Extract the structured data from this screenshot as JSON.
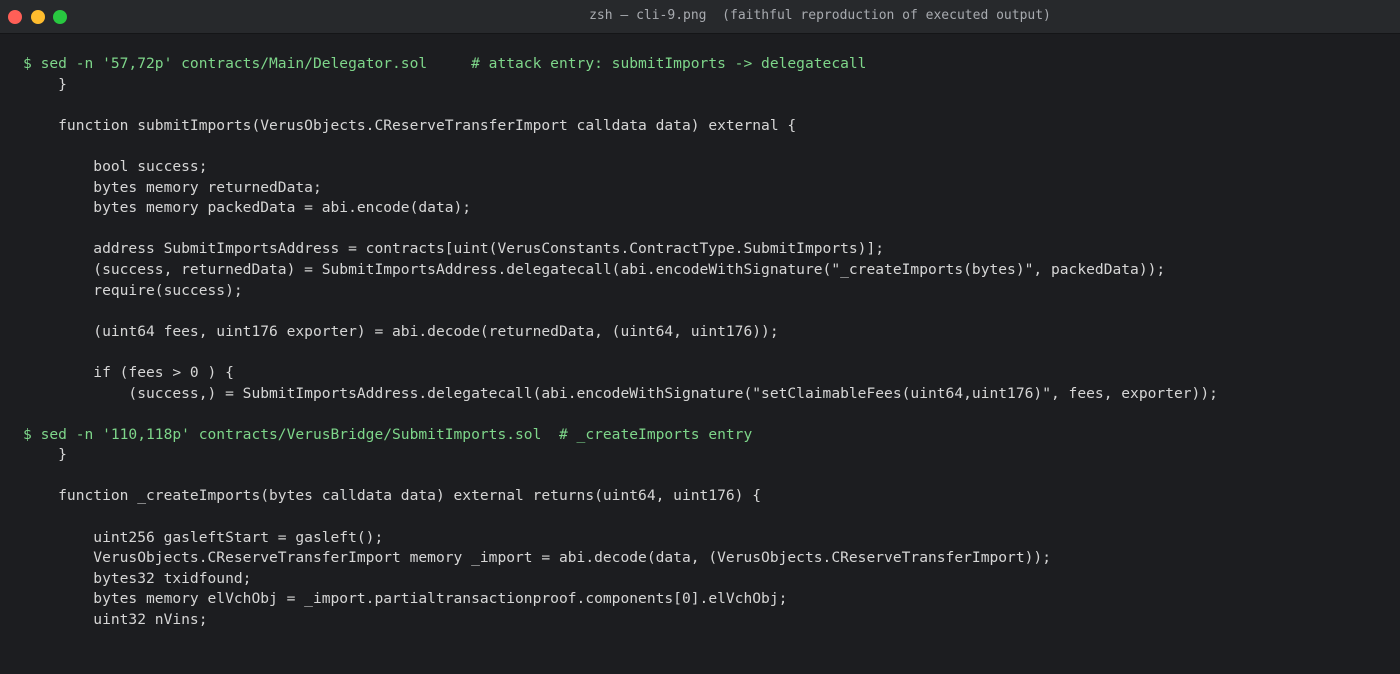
{
  "window": {
    "title": "zsh — cli-9.png  (faithful reproduction of executed output)"
  },
  "terminal": {
    "lines": [
      {
        "kind": "cmd",
        "text": "$ sed -n '57,72p' contracts/Main/Delegator.sol     # attack entry: submitImports -> delegatecall"
      },
      {
        "kind": "out",
        "text": "    }"
      },
      {
        "kind": "out",
        "text": ""
      },
      {
        "kind": "out",
        "text": "    function submitImports(VerusObjects.CReserveTransferImport calldata data) external {"
      },
      {
        "kind": "out",
        "text": ""
      },
      {
        "kind": "out",
        "text": "        bool success;"
      },
      {
        "kind": "out",
        "text": "        bytes memory returnedData;"
      },
      {
        "kind": "out",
        "text": "        bytes memory packedData = abi.encode(data);"
      },
      {
        "kind": "out",
        "text": ""
      },
      {
        "kind": "out",
        "text": "        address SubmitImportsAddress = contracts[uint(VerusConstants.ContractType.SubmitImports)];"
      },
      {
        "kind": "out",
        "text": "        (success, returnedData) = SubmitImportsAddress.delegatecall(abi.encodeWithSignature(\"_createImports(bytes)\", packedData));"
      },
      {
        "kind": "out",
        "text": "        require(success);"
      },
      {
        "kind": "out",
        "text": ""
      },
      {
        "kind": "out",
        "text": "        (uint64 fees, uint176 exporter) = abi.decode(returnedData, (uint64, uint176));"
      },
      {
        "kind": "out",
        "text": ""
      },
      {
        "kind": "out",
        "text": "        if (fees > 0 ) {"
      },
      {
        "kind": "out",
        "text": "            (success,) = SubmitImportsAddress.delegatecall(abi.encodeWithSignature(\"setClaimableFees(uint64,uint176)\", fees, exporter));"
      },
      {
        "kind": "out",
        "text": ""
      },
      {
        "kind": "cmd",
        "text": "$ sed -n '110,118p' contracts/VerusBridge/SubmitImports.sol  # _createImports entry"
      },
      {
        "kind": "out",
        "text": "    }"
      },
      {
        "kind": "out",
        "text": ""
      },
      {
        "kind": "out",
        "text": "    function _createImports(bytes calldata data) external returns(uint64, uint176) {"
      },
      {
        "kind": "out",
        "text": ""
      },
      {
        "kind": "out",
        "text": "        uint256 gasleftStart = gasleft();"
      },
      {
        "kind": "out",
        "text": "        VerusObjects.CReserveTransferImport memory _import = abi.decode(data, (VerusObjects.CReserveTransferImport));"
      },
      {
        "kind": "out",
        "text": "        bytes32 txidfound;"
      },
      {
        "kind": "out",
        "text": "        bytes memory elVchObj = _import.partialtransactionproof.components[0].elVchObj;"
      },
      {
        "kind": "out",
        "text": "        uint32 nVins;"
      }
    ]
  },
  "colors": {
    "background": "#1c1d20",
    "titlebar": "#27292c",
    "command": "#7ed68a",
    "output": "#d6d6d6"
  }
}
